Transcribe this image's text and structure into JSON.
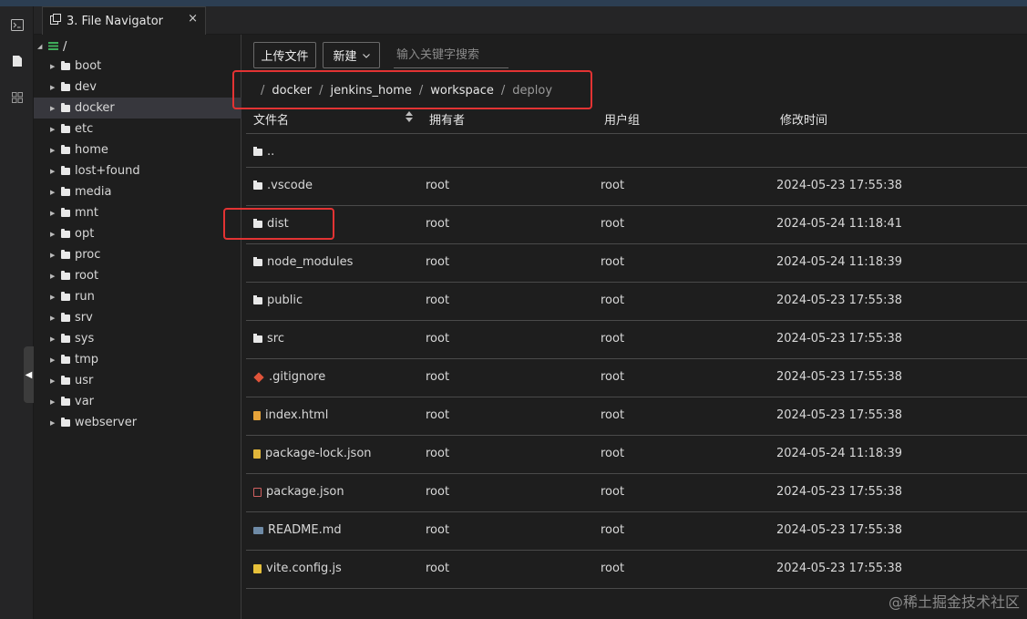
{
  "tab": {
    "label": "3. File Navigator",
    "close": "×"
  },
  "activity_icons": [
    "terminal-icon",
    "file-icon",
    "extensions-icon"
  ],
  "tree": {
    "root_label": "/",
    "items": [
      "boot",
      "dev",
      "docker",
      "etc",
      "home",
      "lost+found",
      "media",
      "mnt",
      "opt",
      "proc",
      "root",
      "run",
      "srv",
      "sys",
      "tmp",
      "usr",
      "var",
      "webserver"
    ],
    "selected": "docker"
  },
  "toolbar": {
    "upload_label": "上传文件",
    "new_label": "新建",
    "search_placeholder": "输入关键字搜索"
  },
  "breadcrumb": {
    "separator": "/",
    "segments": [
      "docker",
      "jenkins_home",
      "workspace",
      "deploy"
    ]
  },
  "table": {
    "headers": {
      "name": "文件名",
      "owner": "拥有者",
      "group": "用户组",
      "modified": "修改时间"
    },
    "rows": [
      {
        "name": "..",
        "icon": "folder-icon",
        "owner": "",
        "group": "",
        "modified": ""
      },
      {
        "name": ".vscode",
        "icon": "folder-icon",
        "owner": "root",
        "group": "root",
        "modified": "2024-05-23 17:55:38"
      },
      {
        "name": "dist",
        "icon": "folder-icon",
        "owner": "root",
        "group": "root",
        "modified": "2024-05-24 11:18:41"
      },
      {
        "name": "node_modules",
        "icon": "folder-icon",
        "owner": "root",
        "group": "root",
        "modified": "2024-05-24 11:18:39"
      },
      {
        "name": "public",
        "icon": "folder-icon",
        "owner": "root",
        "group": "root",
        "modified": "2024-05-23 17:55:38"
      },
      {
        "name": "src",
        "icon": "folder-icon",
        "owner": "root",
        "group": "root",
        "modified": "2024-05-23 17:55:38"
      },
      {
        "name": ".gitignore",
        "icon": "git-icon",
        "owner": "root",
        "group": "root",
        "modified": "2024-05-23 17:55:38"
      },
      {
        "name": "index.html",
        "icon": "html-icon",
        "owner": "root",
        "group": "root",
        "modified": "2024-05-23 17:55:38"
      },
      {
        "name": "package-lock.json",
        "icon": "lock-icon",
        "owner": "root",
        "group": "root",
        "modified": "2024-05-24 11:18:39"
      },
      {
        "name": "package.json",
        "icon": "json-icon",
        "owner": "root",
        "group": "root",
        "modified": "2024-05-23 17:55:38"
      },
      {
        "name": "README.md",
        "icon": "markdown-icon",
        "owner": "root",
        "group": "root",
        "modified": "2024-05-23 17:55:38"
      },
      {
        "name": "vite.config.js",
        "icon": "js-icon",
        "owner": "root",
        "group": "root",
        "modified": "2024-05-23 17:55:38"
      }
    ]
  },
  "colors": {
    "annotation": "#e33333",
    "selected_bg": "#37373d",
    "topbar": "#2c3e52"
  },
  "watermark": "@稀土掘金技术社区"
}
